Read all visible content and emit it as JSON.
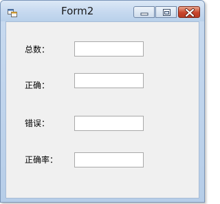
{
  "window": {
    "title": "Form2"
  },
  "icons": {
    "app": "form-icon",
    "minimize": "minimize-icon",
    "maximize": "maximize-icon",
    "close": "close-icon"
  },
  "fields": [
    {
      "label": "总数：",
      "value": ""
    },
    {
      "label": "正确：",
      "value": ""
    },
    {
      "label": "错误：",
      "value": ""
    },
    {
      "label": "正确率：",
      "value": ""
    }
  ]
}
